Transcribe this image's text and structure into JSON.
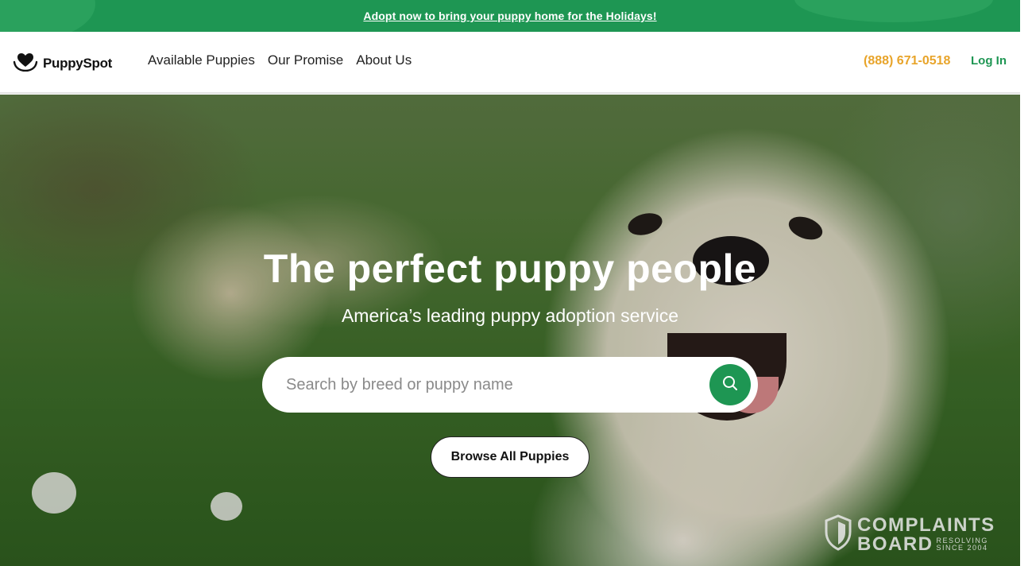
{
  "promo": {
    "text": "Adopt now to bring your puppy home for the Holidays!"
  },
  "header": {
    "logo_text": "PuppySpot",
    "nav": [
      {
        "label": "Available Puppies"
      },
      {
        "label": "Our Promise"
      },
      {
        "label": "About Us"
      }
    ],
    "phone": "(888) 671-0518",
    "login": "Log In"
  },
  "hero": {
    "title": "The perfect puppy people",
    "subtitle": "America’s leading puppy adoption service",
    "search": {
      "placeholder": "Search by breed or puppy name",
      "value": ""
    },
    "browse_label": "Browse All Puppies"
  },
  "badge": {
    "line1": "COMPLAINTS",
    "line2": "BOARD",
    "small1": "RESOLVING",
    "small2": "SINCE 2004"
  },
  "colors": {
    "brand_green": "#1e9653",
    "phone_orange": "#e8a42a"
  },
  "icons": [
    "paw-heart-logo-icon",
    "search-icon",
    "shield-icon"
  ]
}
